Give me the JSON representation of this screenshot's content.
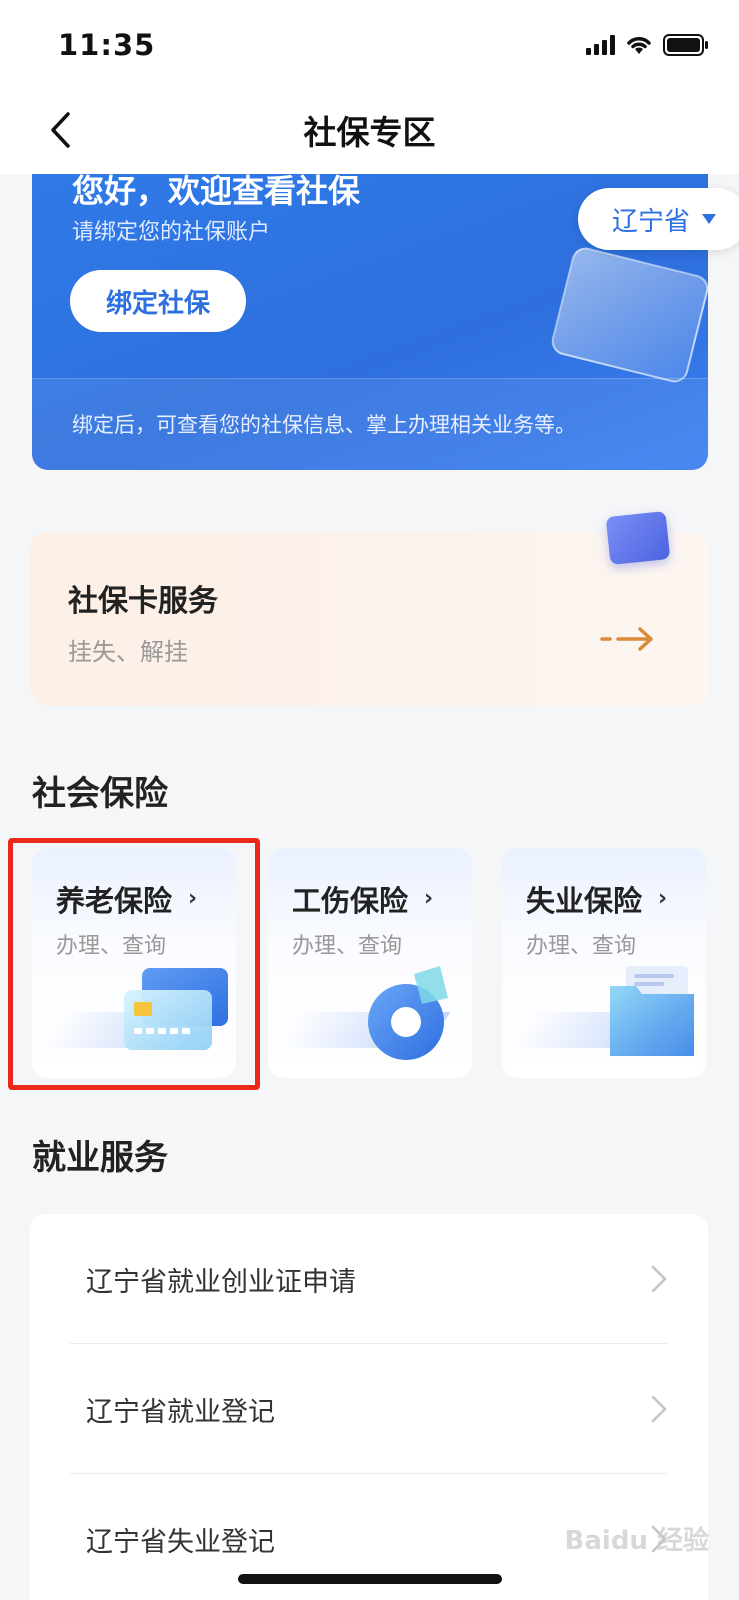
{
  "status_bar": {
    "time": "11:35"
  },
  "nav": {
    "title": "社保专区"
  },
  "hero": {
    "title": "您好，欢迎查看社保",
    "subtitle": "请绑定您的社保账户",
    "bind_button": "绑定社保",
    "footer_text": "绑定后，可查看您的社保信息、掌上办理相关业务等。",
    "region": "辽宁省"
  },
  "card_service": {
    "title": "社保卡服务",
    "subtitle": "挂失、解挂"
  },
  "social_insurance": {
    "section_title": "社会保险",
    "items": [
      {
        "title": "养老保险",
        "subtitle": "办理、查询"
      },
      {
        "title": "工伤保险",
        "subtitle": "办理、查询"
      },
      {
        "title": "失业保险",
        "subtitle": "办理、查询"
      }
    ]
  },
  "employment": {
    "section_title": "就业服务",
    "items": [
      {
        "label": "辽宁省就业创业证申请"
      },
      {
        "label": "辽宁省就业登记"
      },
      {
        "label": "辽宁省失业登记"
      }
    ]
  },
  "watermark": "Baidu 经验",
  "colors": {
    "primary_blue": "#2c6fe0",
    "highlight_red": "#e8291c",
    "arrow_orange": "#d98a3a"
  }
}
